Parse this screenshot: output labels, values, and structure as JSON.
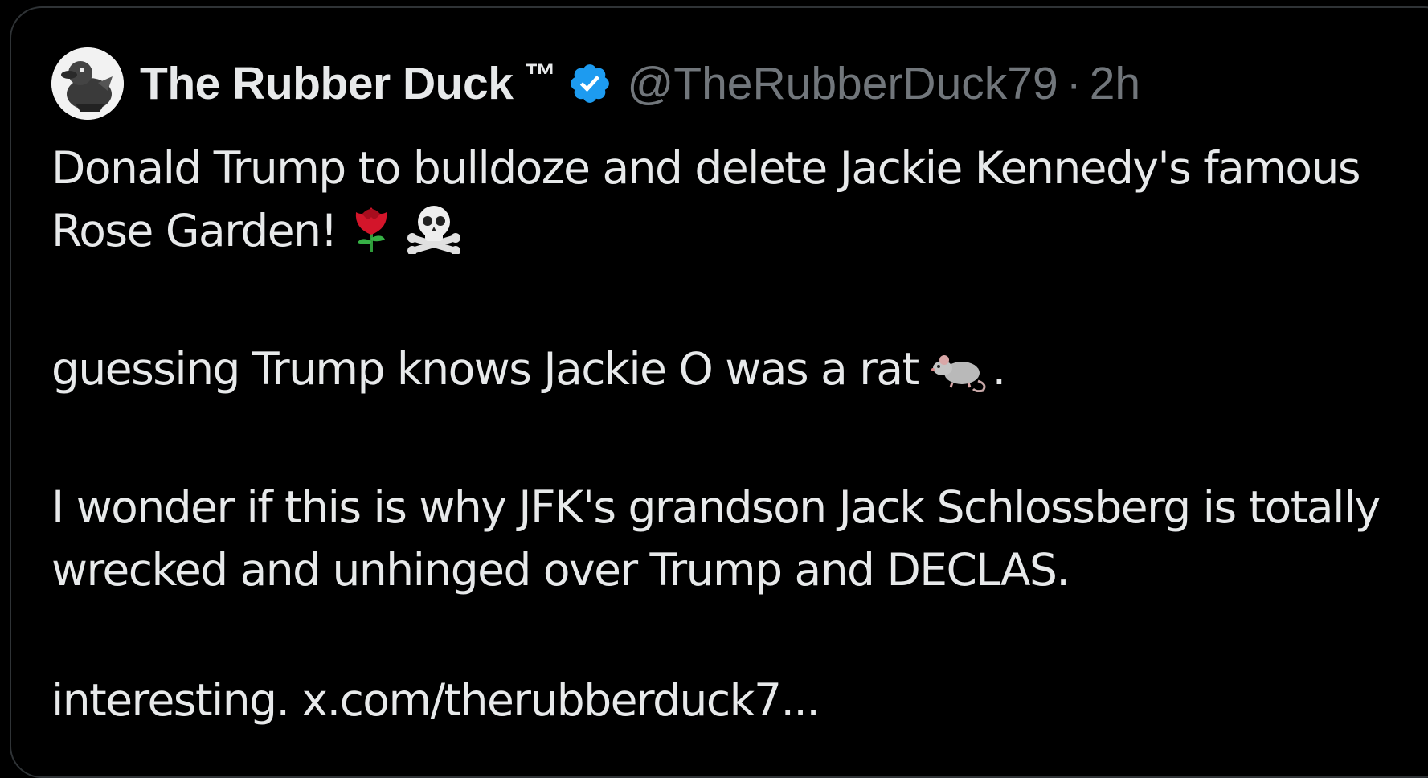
{
  "post": {
    "display_name": "The Rubber Duck",
    "trademark": "™",
    "handle": "@TheRubberDuck79",
    "separator": "·",
    "time": "2h",
    "verified": true,
    "paragraph1": "Donald Trump to bulldoze and delete Jackie Kennedy's famous Rose Garden!",
    "paragraph2": "guessing Trump knows Jackie O was a rat",
    "paragraph2_end": ".",
    "paragraph3": "I wonder if this is why JFK's grandson Jack Schlossberg is totally wrecked and unhinged over Trump and DECLAS.",
    "paragraph4": "interesting.",
    "link_text": "x.com/therubberduck7..."
  },
  "icons": {
    "avatar": "rubber-duck-avatar",
    "verified": "verified-badge-icon",
    "emoji1": "rose-emoji",
    "emoji2": "skull-crossbones-emoji",
    "emoji3": "rat-emoji"
  },
  "colors": {
    "background": "#000000",
    "text": "#e7e9ea",
    "secondary": "#71767b",
    "verified": "#1d9bf0"
  }
}
